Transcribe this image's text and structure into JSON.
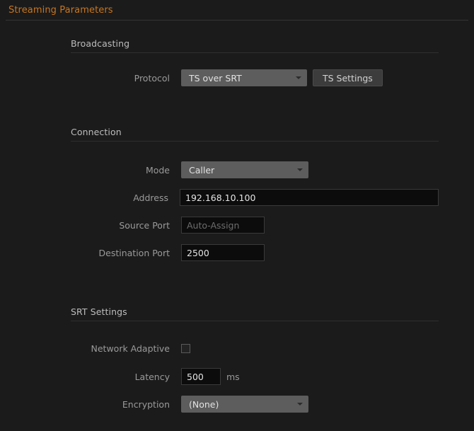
{
  "window": {
    "title": "Streaming Parameters"
  },
  "sections": {
    "broadcasting": {
      "heading": "Broadcasting",
      "protocol": {
        "label": "Protocol",
        "value": "TS over SRT",
        "caret_icon": "chevron-down-icon"
      },
      "ts_settings_button": "TS Settings"
    },
    "connection": {
      "heading": "Connection",
      "mode": {
        "label": "Mode",
        "value": "Caller",
        "caret_icon": "chevron-down-icon"
      },
      "address": {
        "label": "Address",
        "value": "192.168.10.100",
        "placeholder": ""
      },
      "source_port": {
        "label": "Source Port",
        "value": "",
        "placeholder": "Auto-Assign"
      },
      "destination_port": {
        "label": "Destination Port",
        "value": "2500",
        "placeholder": ""
      }
    },
    "srt_settings": {
      "heading": "SRT Settings",
      "network_adaptive": {
        "label": "Network Adaptive",
        "checked": false
      },
      "latency": {
        "label": "Latency",
        "value": "500",
        "placeholder": "",
        "unit": "ms"
      },
      "encryption": {
        "label": "Encryption",
        "value": "(None)",
        "caret_icon": "chevron-down-icon"
      }
    }
  },
  "colors": {
    "background": "#1b1b1b",
    "title_accent": "#c8761e",
    "dropdown_bg": "#5d5d5d",
    "button_bg": "#3c3c3c",
    "input_bg": "#0c0c0c",
    "label_text": "#9a9a9a"
  }
}
